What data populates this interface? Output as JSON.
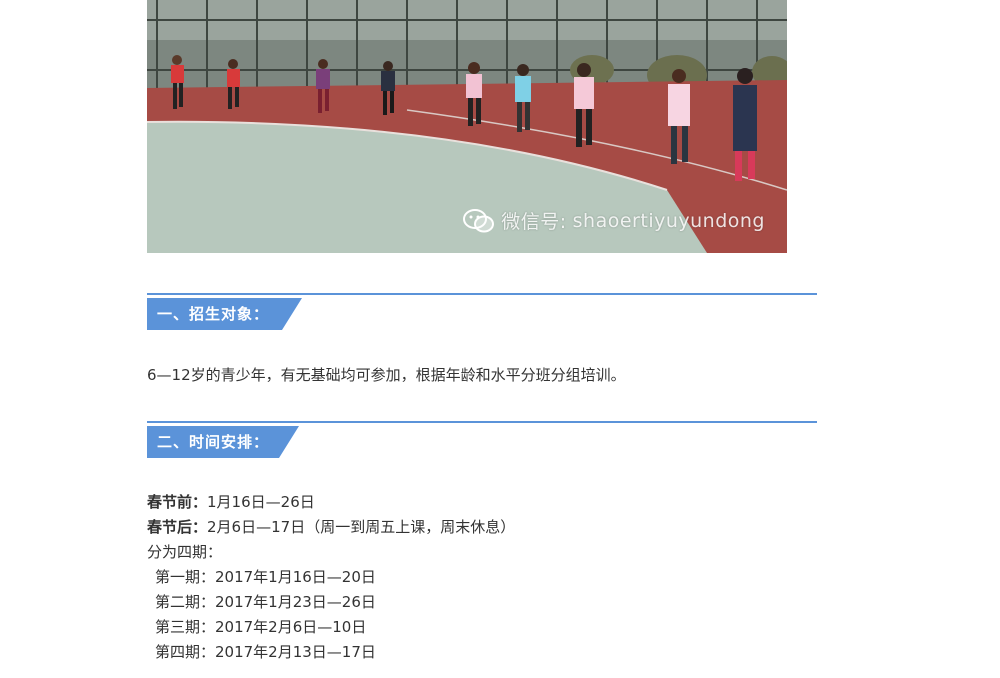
{
  "photo": {
    "watermark_prefix": "微信号: ",
    "watermark_id": "shaoertiyuyundong",
    "colors": {
      "sky": "#8f9a93",
      "track": "#a64b45",
      "field": "#b7c8bd",
      "fence": "#3e4640"
    }
  },
  "section1": {
    "title": "一、招生对象：",
    "body": "6—12岁的青少年，有无基础均可参加，根据年龄和水平分班分组培训。"
  },
  "section2": {
    "title": "二、时间安排：",
    "before_label": "春节前：",
    "before_value": "1月16日—26日",
    "after_label": "春节后：",
    "after_value": "2月6日—17日（周一到周五上课，周末休息）",
    "periods_label": "分为四期：",
    "periods": [
      "第一期：2017年1月16日—20日",
      "第二期：2017年1月23日—26日",
      "第三期：2017年2月6日—10日",
      "第四期：2017年2月13日—17日"
    ]
  },
  "theme": {
    "accent": "#5b93d9",
    "text": "#333333"
  }
}
